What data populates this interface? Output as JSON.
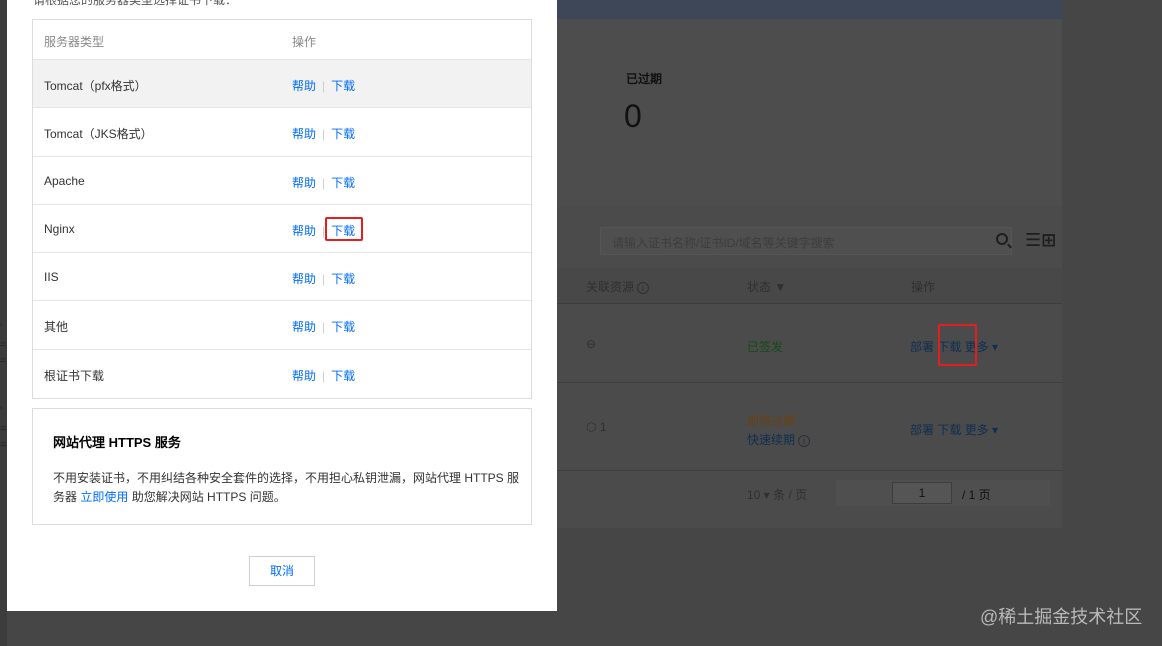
{
  "background": {
    "stat_label": "已过期",
    "stat_value": "0",
    "search_placeholder": "请输入证书名称/证书ID/域名等关键字搜索",
    "columns": {
      "resource": "关联资源",
      "status": "状态",
      "action": "操作"
    },
    "rows": [
      {
        "resource": "⊖",
        "status": "已签发",
        "ops": [
          "部署",
          "下载",
          "更多 ▾"
        ]
      },
      {
        "resource": "1",
        "status": "即将过期",
        "renew": "快速续期",
        "ops": [
          "部署",
          "下载",
          "更多 ▾"
        ]
      }
    ],
    "pager": {
      "page_size": "10 ▾",
      "per_page": "条 / 页",
      "current": "1",
      "total": "/ 1 页"
    }
  },
  "dialog": {
    "intro": "请根据您的服务器类型选择证书下载：",
    "columns": {
      "server_type": "服务器类型",
      "action": "操作"
    },
    "help_label": "帮助",
    "download_label": "下载",
    "rows": [
      {
        "name": "Tomcat（pfx格式）"
      },
      {
        "name": "Tomcat（JKS格式）"
      },
      {
        "name": "Apache"
      },
      {
        "name": "Nginx"
      },
      {
        "name": "IIS"
      },
      {
        "name": "其他"
      },
      {
        "name": "根证书下载"
      }
    ],
    "promo": {
      "title": "网站代理 HTTPS 服务",
      "text_before": "不用安装证书，不用纠结各种安全套件的选择，不用担心私钥泄漏，网站代理 HTTPS 服务器 ",
      "link": "立即使用",
      "text_after": " 助您解决网站 HTTPS 问题。"
    },
    "cancel_label": "取消"
  },
  "watermark": "@稀土掘金技术社区",
  "colors": {
    "link": "#006eff",
    "highlight": "#e02020"
  }
}
